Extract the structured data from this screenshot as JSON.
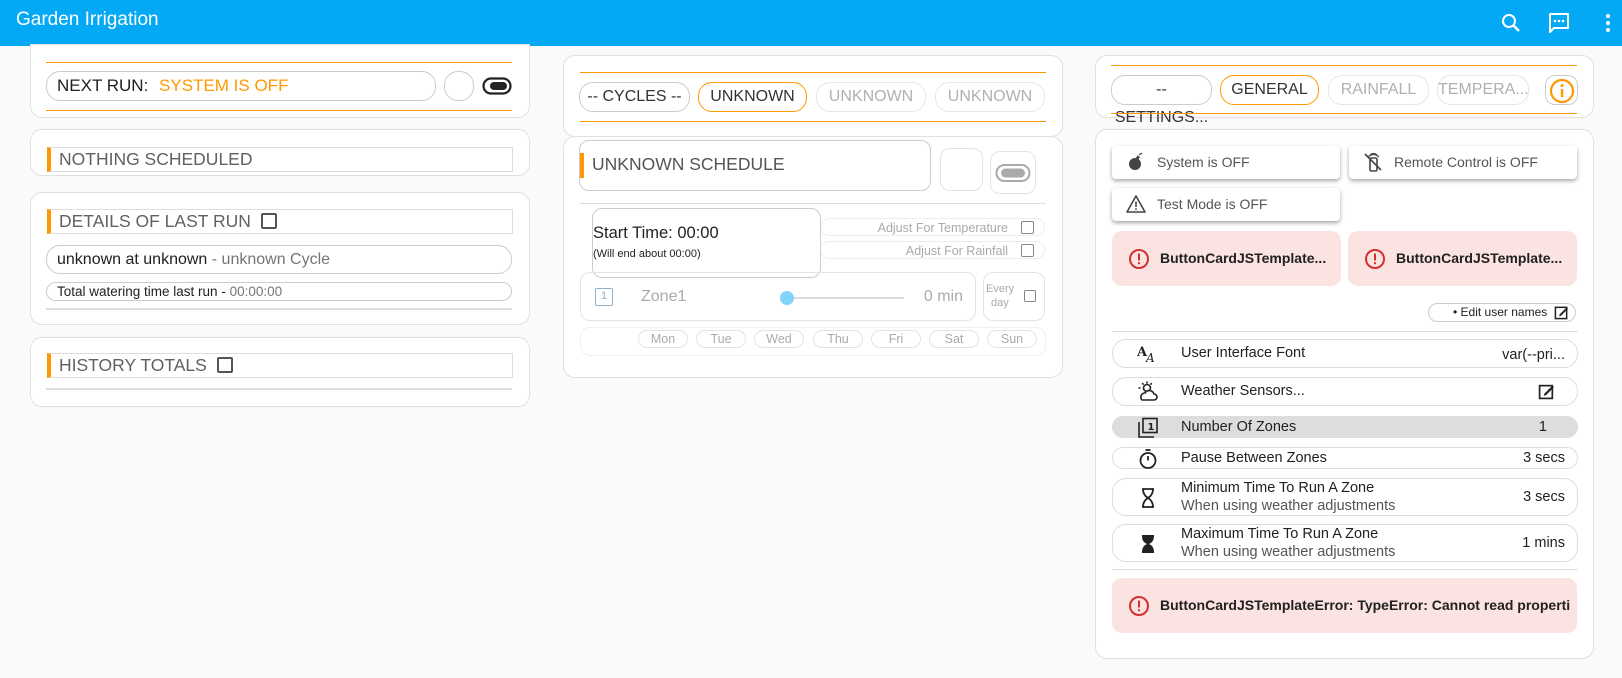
{
  "app": {
    "title": "Garden Irrigation"
  },
  "toolbar": {
    "search_icon": "search-icon",
    "chat_icon": "chat-icon",
    "menu_icon": "more-vert-icon"
  },
  "next_run": {
    "label": "NEXT RUN:",
    "value": "SYSTEM IS OFF"
  },
  "nothing_scheduled": {
    "title": "NOTHING SCHEDULED"
  },
  "last_run": {
    "title": "DETAILS OF LAST RUN",
    "summary_main": "unknown at unknown",
    "summary_sep": " - ",
    "summary_cycle": "unknown Cycle",
    "total_label": "Total watering time last run - ",
    "total_value": "00:00:00"
  },
  "history": {
    "title": "HISTORY TOTALS"
  },
  "cycles": {
    "tabs": [
      "-- CYCLES --",
      "UNKNOWN",
      "UNKNOWN",
      "UNKNOWN"
    ]
  },
  "schedule": {
    "title": "UNKNOWN SCHEDULE",
    "start_time": "Start Time: 00:00",
    "end_note": "(Will end about 00:00)",
    "adjust_temp": "Adjust For Temperature",
    "adjust_rain": "Adjust For Rainfall",
    "zone_number": "1",
    "zone_name": "Zone1",
    "zone_value": "0 min",
    "every_day_1": "Every",
    "every_day_2": "day",
    "days": [
      "Mon",
      "Tue",
      "Wed",
      "Thu",
      "Fri",
      "Sat",
      "Sun"
    ]
  },
  "settings": {
    "tabs": [
      "-- SETTINGS...",
      "GENERAL",
      "RAINFALL",
      "TEMPERA..."
    ],
    "status": {
      "system": "System is OFF",
      "remote": "Remote Control is OFF",
      "test": "Test Mode is OFF"
    },
    "errors": {
      "e1": "ButtonCardJSTemplate...",
      "e2": "ButtonCardJSTemplate...",
      "e3": "ButtonCardJSTemplateError: TypeError: Cannot read propertie..."
    },
    "edit_names": "• Edit user names",
    "rows": {
      "font": {
        "label": "User Interface Font",
        "value": "var(--pri..."
      },
      "weather": {
        "label": "Weather Sensors..."
      },
      "zones": {
        "label": "Number Of Zones",
        "value": "1"
      },
      "pause": {
        "label": "Pause Between Zones",
        "value": "3 secs"
      },
      "min": {
        "label": "Minimum Time To Run A Zone",
        "sub": "When using weather adjustments",
        "value": "3 secs"
      },
      "max": {
        "label": "Maximum Time To Run A Zone",
        "sub": "When using weather adjustments",
        "value": "1 mins"
      }
    }
  },
  "colors": {
    "header": "#03a9f4",
    "accent": "#ff9800",
    "error_bg": "#fbe3e1",
    "error_icon": "#d32f2f",
    "slider": "#81d4fa"
  }
}
